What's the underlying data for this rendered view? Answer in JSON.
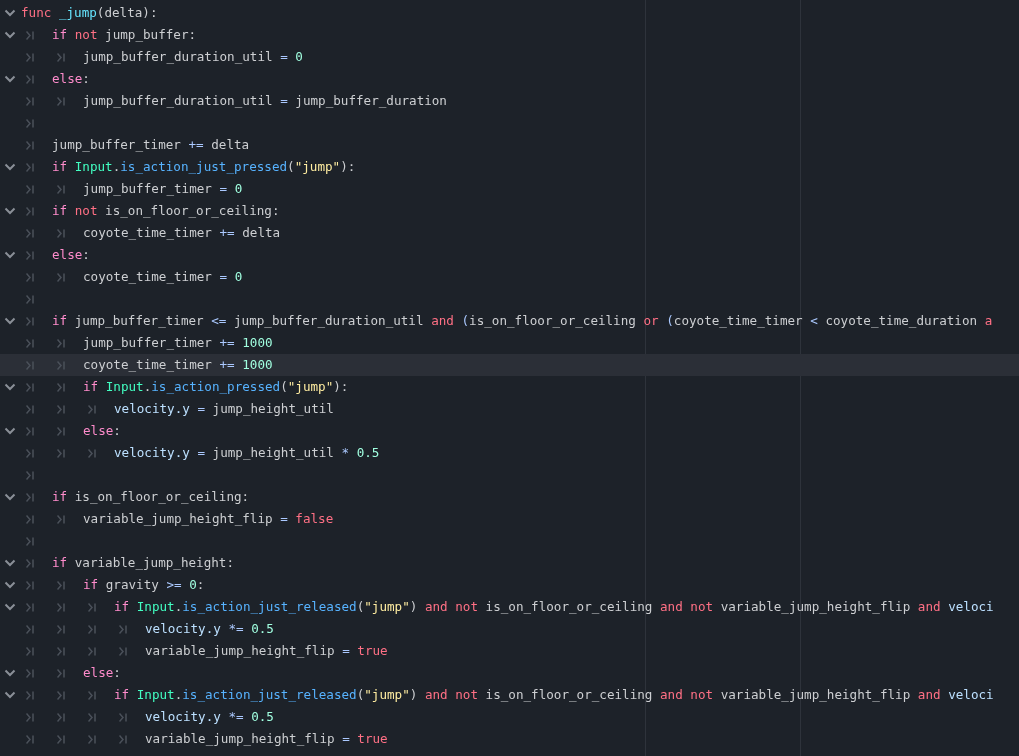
{
  "editor": {
    "lines": [
      {
        "foldable": true,
        "current": false,
        "code": [
          {
            "kind": "keyword",
            "text": "func "
          },
          {
            "kind": "name",
            "text": "_jump"
          },
          {
            "kind": "plain",
            "text": "(delta):"
          }
        ],
        "children": [
          {
            "foldable": true,
            "current": false,
            "code": [
              {
                "kind": "control",
                "text": "if "
              },
              {
                "kind": "keyword",
                "text": "not "
              },
              {
                "kind": "plain",
                "text": "jump_buffer:"
              }
            ],
            "children": [
              {
                "foldable": false,
                "current": false,
                "code": [
                  {
                    "kind": "plain",
                    "text": "jump_buffer_duration_util "
                  },
                  {
                    "kind": "op",
                    "text": "= "
                  },
                  {
                    "kind": "number",
                    "text": "0"
                  }
                ]
              }
            ]
          },
          {
            "foldable": true,
            "current": false,
            "code": [
              {
                "kind": "control",
                "text": "else"
              },
              {
                "kind": "plain",
                "text": ":"
              }
            ],
            "children": [
              {
                "foldable": false,
                "current": false,
                "code": [
                  {
                    "kind": "plain",
                    "text": "jump_buffer_duration_util "
                  },
                  {
                    "kind": "op",
                    "text": "= "
                  },
                  {
                    "kind": "plain",
                    "text": "jump_buffer_duration"
                  }
                ]
              }
            ]
          },
          {
            "foldable": false,
            "current": false
          },
          {
            "foldable": false,
            "current": false,
            "code": [
              {
                "kind": "plain",
                "text": "jump_buffer_timer "
              },
              {
                "kind": "op",
                "text": "+= "
              },
              {
                "kind": "plain",
                "text": "delta"
              }
            ]
          },
          {
            "foldable": true,
            "current": false,
            "code": [
              {
                "kind": "control",
                "text": "if "
              },
              {
                "kind": "class",
                "text": "Input"
              },
              {
                "kind": "plain",
                "text": "."
              },
              {
                "kind": "call",
                "text": "is_action_just_pressed"
              },
              {
                "kind": "plain",
                "text": "("
              },
              {
                "kind": "string",
                "text": "\"jump\""
              },
              {
                "kind": "plain",
                "text": "):"
              }
            ],
            "children": [
              {
                "foldable": false,
                "current": false,
                "code": [
                  {
                    "kind": "plain",
                    "text": "jump_buffer_timer "
                  },
                  {
                    "kind": "op",
                    "text": "= "
                  },
                  {
                    "kind": "number",
                    "text": "0"
                  }
                ]
              }
            ]
          },
          {
            "foldable": true,
            "current": false,
            "code": [
              {
                "kind": "control",
                "text": "if "
              },
              {
                "kind": "keyword",
                "text": "not "
              },
              {
                "kind": "plain",
                "text": "is_on_floor_or_ceiling:"
              }
            ],
            "children": [
              {
                "foldable": false,
                "current": false,
                "code": [
                  {
                    "kind": "plain",
                    "text": "coyote_time_timer "
                  },
                  {
                    "kind": "op",
                    "text": "+= "
                  },
                  {
                    "kind": "plain",
                    "text": "delta"
                  }
                ]
              }
            ]
          },
          {
            "foldable": true,
            "current": false,
            "code": [
              {
                "kind": "control",
                "text": "else"
              },
              {
                "kind": "plain",
                "text": ":"
              }
            ],
            "children": [
              {
                "foldable": false,
                "current": false,
                "code": [
                  {
                    "kind": "plain",
                    "text": "coyote_time_timer "
                  },
                  {
                    "kind": "op",
                    "text": "= "
                  },
                  {
                    "kind": "number",
                    "text": "0"
                  }
                ]
              }
            ]
          },
          {
            "foldable": false,
            "current": false
          },
          {
            "foldable": true,
            "current": false,
            "code": [
              {
                "kind": "control",
                "text": "if "
              },
              {
                "kind": "plain",
                "text": "jump_buffer_timer "
              },
              {
                "kind": "op",
                "text": "<= "
              },
              {
                "kind": "plain",
                "text": "jump_buffer_duration_util "
              },
              {
                "kind": "keyword",
                "text": "and "
              },
              {
                "kind": "op",
                "text": "("
              },
              {
                "kind": "plain",
                "text": "is_on_floor_or_ceiling "
              },
              {
                "kind": "keyword",
                "text": "or "
              },
              {
                "kind": "op",
                "text": "("
              },
              {
                "kind": "plain",
                "text": "coyote_time_timer "
              },
              {
                "kind": "op",
                "text": "< "
              },
              {
                "kind": "plain",
                "text": "coyote_time_duration "
              },
              {
                "kind": "keyword",
                "text": "a"
              }
            ],
            "children": [
              {
                "foldable": false,
                "current": false,
                "code": [
                  {
                    "kind": "plain",
                    "text": "jump_buffer_timer "
                  },
                  {
                    "kind": "op",
                    "text": "+= "
                  },
                  {
                    "kind": "number",
                    "text": "1000"
                  }
                ]
              },
              {
                "foldable": false,
                "current": true,
                "code": [
                  {
                    "kind": "plain",
                    "text": "coyote_time_timer "
                  },
                  {
                    "kind": "op",
                    "text": "+= "
                  },
                  {
                    "kind": "number",
                    "text": "1000"
                  }
                ]
              },
              {
                "foldable": true,
                "current": false,
                "code": [
                  {
                    "kind": "control",
                    "text": "if "
                  },
                  {
                    "kind": "class",
                    "text": "Input"
                  },
                  {
                    "kind": "plain",
                    "text": "."
                  },
                  {
                    "kind": "call",
                    "text": "is_action_pressed"
                  },
                  {
                    "kind": "plain",
                    "text": "("
                  },
                  {
                    "kind": "string",
                    "text": "\"jump\""
                  },
                  {
                    "kind": "plain",
                    "text": "):"
                  }
                ],
                "children": [
                  {
                    "foldable": false,
                    "current": false,
                    "code": [
                      {
                        "kind": "member",
                        "text": "velocity.y "
                      },
                      {
                        "kind": "op",
                        "text": "= "
                      },
                      {
                        "kind": "plain",
                        "text": "jump_height_util"
                      }
                    ]
                  }
                ]
              },
              {
                "foldable": true,
                "current": false,
                "code": [
                  {
                    "kind": "control",
                    "text": "else"
                  },
                  {
                    "kind": "plain",
                    "text": ":"
                  }
                ],
                "children": [
                  {
                    "foldable": false,
                    "current": false,
                    "code": [
                      {
                        "kind": "member",
                        "text": "velocity.y "
                      },
                      {
                        "kind": "op",
                        "text": "= "
                      },
                      {
                        "kind": "plain",
                        "text": "jump_height_util "
                      },
                      {
                        "kind": "op",
                        "text": "* "
                      },
                      {
                        "kind": "number",
                        "text": "0.5"
                      }
                    ]
                  }
                ]
              }
            ]
          },
          {
            "foldable": false,
            "current": false
          },
          {
            "foldable": true,
            "current": false,
            "code": [
              {
                "kind": "control",
                "text": "if "
              },
              {
                "kind": "plain",
                "text": "is_on_floor_or_ceiling:"
              }
            ],
            "children": [
              {
                "foldable": false,
                "current": false,
                "code": [
                  {
                    "kind": "plain",
                    "text": "variable_jump_height_flip "
                  },
                  {
                    "kind": "op",
                    "text": "= "
                  },
                  {
                    "kind": "keyword",
                    "text": "false"
                  }
                ]
              }
            ]
          },
          {
            "foldable": false,
            "current": false
          },
          {
            "foldable": true,
            "current": false,
            "code": [
              {
                "kind": "control",
                "text": "if "
              },
              {
                "kind": "plain",
                "text": "variable_jump_height:"
              }
            ],
            "children": [
              {
                "foldable": true,
                "current": false,
                "code": [
                  {
                    "kind": "control",
                    "text": "if "
                  },
                  {
                    "kind": "plain",
                    "text": "gravity "
                  },
                  {
                    "kind": "op",
                    "text": ">= "
                  },
                  {
                    "kind": "number",
                    "text": "0"
                  },
                  {
                    "kind": "plain",
                    "text": ":"
                  }
                ],
                "children": [
                  {
                    "foldable": true,
                    "current": false,
                    "code": [
                      {
                        "kind": "control",
                        "text": "if "
                      },
                      {
                        "kind": "class",
                        "text": "Input"
                      },
                      {
                        "kind": "plain",
                        "text": "."
                      },
                      {
                        "kind": "call",
                        "text": "is_action_just_released"
                      },
                      {
                        "kind": "plain",
                        "text": "("
                      },
                      {
                        "kind": "string",
                        "text": "\"jump\""
                      },
                      {
                        "kind": "plain",
                        "text": ") "
                      },
                      {
                        "kind": "keyword",
                        "text": "and not "
                      },
                      {
                        "kind": "plain",
                        "text": "is_on_floor_or_ceiling "
                      },
                      {
                        "kind": "keyword",
                        "text": "and not "
                      },
                      {
                        "kind": "plain",
                        "text": "variable_jump_height_flip "
                      },
                      {
                        "kind": "keyword",
                        "text": "and "
                      },
                      {
                        "kind": "member",
                        "text": "veloci"
                      }
                    ],
                    "children": [
                      {
                        "foldable": false,
                        "current": false,
                        "code": [
                          {
                            "kind": "member",
                            "text": "velocity.y "
                          },
                          {
                            "kind": "op",
                            "text": "*= "
                          },
                          {
                            "kind": "number",
                            "text": "0.5"
                          }
                        ]
                      },
                      {
                        "foldable": false,
                        "current": false,
                        "code": [
                          {
                            "kind": "plain",
                            "text": "variable_jump_height_flip "
                          },
                          {
                            "kind": "op",
                            "text": "= "
                          },
                          {
                            "kind": "keyword",
                            "text": "true"
                          }
                        ]
                      }
                    ]
                  }
                ]
              },
              {
                "foldable": true,
                "current": false,
                "code": [
                  {
                    "kind": "control",
                    "text": "else"
                  },
                  {
                    "kind": "plain",
                    "text": ":"
                  }
                ],
                "children": [
                  {
                    "foldable": true,
                    "current": false,
                    "code": [
                      {
                        "kind": "control",
                        "text": "if "
                      },
                      {
                        "kind": "class",
                        "text": "Input"
                      },
                      {
                        "kind": "plain",
                        "text": "."
                      },
                      {
                        "kind": "call",
                        "text": "is_action_just_released"
                      },
                      {
                        "kind": "plain",
                        "text": "("
                      },
                      {
                        "kind": "string",
                        "text": "\"jump\""
                      },
                      {
                        "kind": "plain",
                        "text": ") "
                      },
                      {
                        "kind": "keyword",
                        "text": "and not "
                      },
                      {
                        "kind": "plain",
                        "text": "is_on_floor_or_ceiling "
                      },
                      {
                        "kind": "keyword",
                        "text": "and not "
                      },
                      {
                        "kind": "plain",
                        "text": "variable_jump_height_flip "
                      },
                      {
                        "kind": "keyword",
                        "text": "and "
                      },
                      {
                        "kind": "member",
                        "text": "veloci"
                      }
                    ],
                    "children": [
                      {
                        "foldable": false,
                        "current": false,
                        "code": [
                          {
                            "kind": "member",
                            "text": "velocity.y "
                          },
                          {
                            "kind": "op",
                            "text": "*= "
                          },
                          {
                            "kind": "number",
                            "text": "0.5"
                          }
                        ]
                      },
                      {
                        "foldable": false,
                        "current": false,
                        "code": [
                          {
                            "kind": "plain",
                            "text": "variable_jump_height_flip "
                          },
                          {
                            "kind": "op",
                            "text": "= "
                          },
                          {
                            "kind": "keyword",
                            "text": "true"
                          }
                        ]
                      }
                    ]
                  }
                ]
              }
            ]
          }
        ]
      }
    ]
  }
}
